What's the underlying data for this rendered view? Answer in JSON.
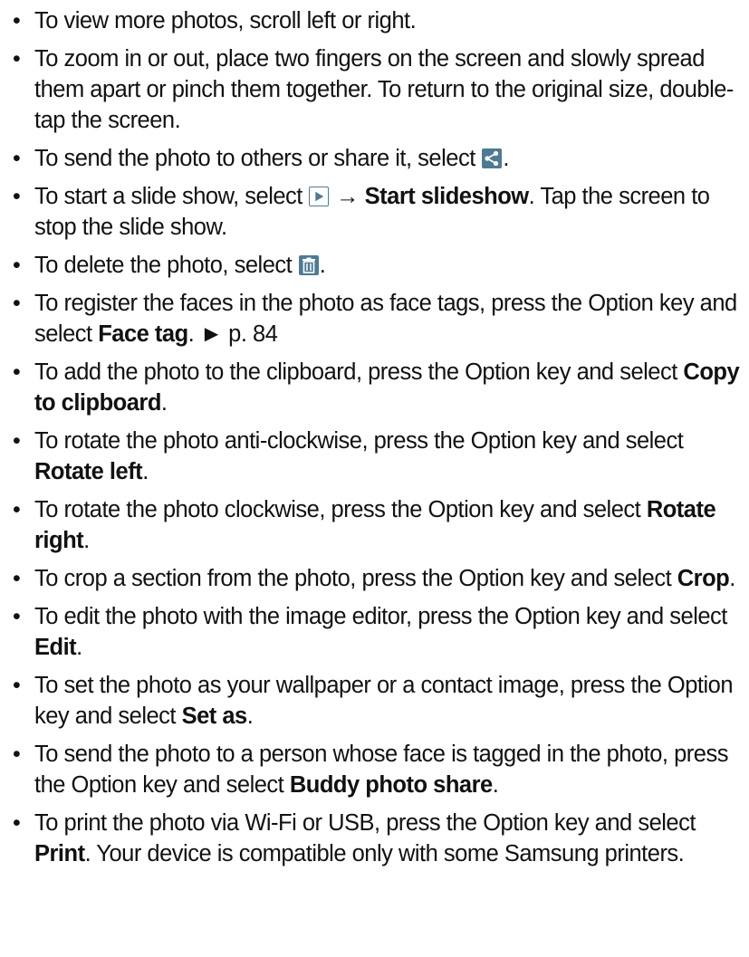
{
  "bullet_glyph": "•",
  "items": [
    {
      "t1": "To view more photos, scroll left or right."
    },
    {
      "t1": "To zoom in or out, place two fingers on the screen and slowly spread them apart or pinch them together. To return to the original size, double-tap the screen."
    },
    {
      "t1": "To send the photo to others or share it, select ",
      "t2": "."
    },
    {
      "t1": "To start a slide show, select ",
      "arrow": " → ",
      "k1": "Start slideshow",
      "t2": ". Tap the screen to stop the slide show."
    },
    {
      "t1": "To delete the photo, select ",
      "t2": "."
    },
    {
      "t1": "To register the faces in the photo as face tags, press the Option key and select ",
      "k1": "Face tag",
      "t2": ". ► p. 84"
    },
    {
      "t1": "To add the photo to the clipboard, press the Option key and select ",
      "k1": "Copy to clipboard",
      "t2": "."
    },
    {
      "t1": "To rotate the photo anti-clockwise, press the Option key and select ",
      "k1": "Rotate left",
      "t2": "."
    },
    {
      "t1": "To rotate the photo clockwise, press the Option key and select ",
      "k1": "Rotate right",
      "t2": "."
    },
    {
      "t1": "To crop a section from the photo, press the Option key and select ",
      "k1": "Crop",
      "t2": "."
    },
    {
      "t1": "To edit the photo with the image editor, press the Option key and select ",
      "k1": "Edit",
      "t2": "."
    },
    {
      "t1": "To set the photo as your wallpaper or a contact image, press the Option key and select ",
      "k1": "Set as",
      "t2": "."
    },
    {
      "t1": "To send the photo to a person whose face is tagged in the photo, press the Option key and select ",
      "k1": "Buddy photo share",
      "t2": "."
    },
    {
      "t1": "To print the photo via Wi-Fi or USB, press the Option key and select ",
      "k1": "Print",
      "t2": ". Your device is compatible only with some Samsung printers."
    }
  ],
  "icons": {
    "share": "share-icon",
    "play": "play-icon",
    "trash": "trash-icon",
    "accent": "#4f7a93"
  }
}
